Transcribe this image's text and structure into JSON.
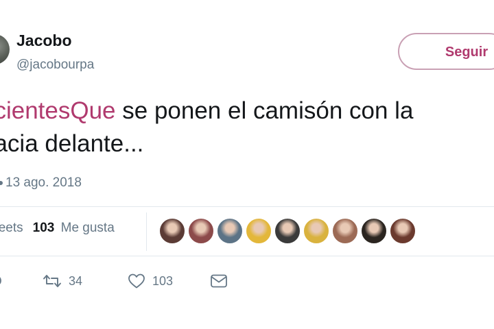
{
  "user": {
    "display_name": "Jacobo",
    "handle": "@jacobourpa"
  },
  "follow_button": {
    "label": "Seguir"
  },
  "tweet": {
    "hashtag": "acientesQue",
    "text_line1_rest": " se ponen el camisón con la",
    "text_line2": "hacia delante...",
    "timestamp": "13 ago. 2018"
  },
  "stats": {
    "retweets_label": "weets",
    "likes_count": "103",
    "likes_label": "Me gusta"
  },
  "likers": [
    {
      "name": "liker-avatar-1",
      "color": "#5b3b35"
    },
    {
      "name": "liker-avatar-2",
      "color": "#8c4a4a"
    },
    {
      "name": "liker-avatar-3",
      "color": "#5c7386"
    },
    {
      "name": "liker-avatar-4",
      "color": "#e3b73a"
    },
    {
      "name": "liker-avatar-5",
      "color": "#3a3a3a"
    },
    {
      "name": "liker-avatar-6",
      "color": "#d9b23e"
    },
    {
      "name": "liker-avatar-7",
      "color": "#9c6a55"
    },
    {
      "name": "liker-avatar-8",
      "color": "#2b2520"
    },
    {
      "name": "liker-avatar-9",
      "color": "#6b3a2e"
    }
  ],
  "actions": {
    "reply_icon": "reply-icon",
    "retweet_icon": "retweet-icon",
    "retweet_count": "34",
    "like_icon": "heart-icon",
    "like_count": "103",
    "message_icon": "envelope-icon"
  },
  "colors": {
    "accent": "#b03a6e",
    "muted_text": "#657786",
    "border": "#e1e8ed"
  }
}
